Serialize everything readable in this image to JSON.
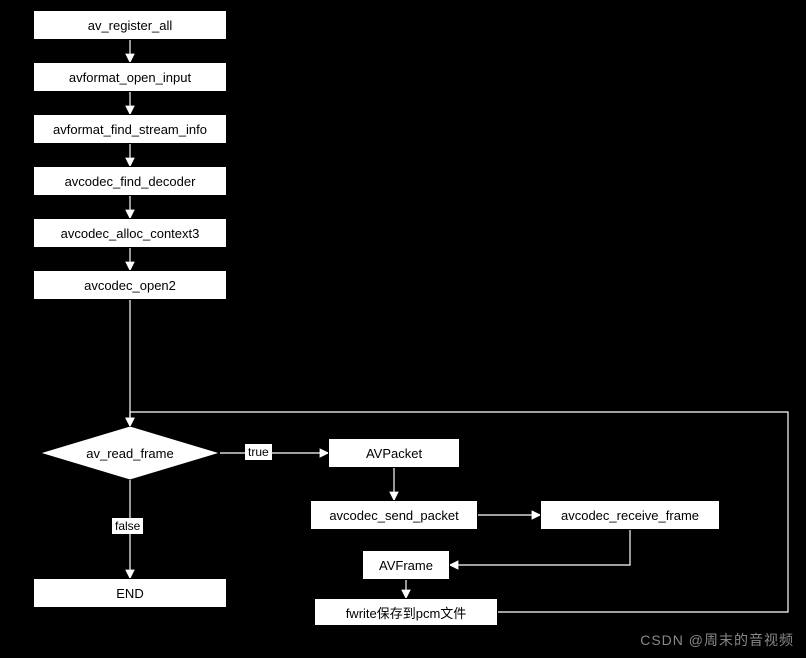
{
  "nodes": {
    "register": "av_register_all",
    "open_input": "avformat_open_input",
    "find_stream": "avformat_find_stream_info",
    "find_decoder": "avcodec_find_decoder",
    "alloc_ctx": "avcodec_alloc_context3",
    "open2": "avcodec_open2",
    "read_frame": "av_read_frame",
    "avpacket": "AVPacket",
    "send_packet": "avcodec_send_packet",
    "receive_frame": "avcodec_receive_frame",
    "avframe": "AVFrame",
    "fwrite": "fwrite保存到pcm文件",
    "end": "END"
  },
  "labels": {
    "true_label": "true",
    "false_label": "false"
  },
  "watermark": "CSDN @周末的音视频",
  "chart_data": {
    "type": "flowchart",
    "title": "",
    "nodes": [
      {
        "id": "register",
        "label": "av_register_all",
        "shape": "rect"
      },
      {
        "id": "open_input",
        "label": "avformat_open_input",
        "shape": "rect"
      },
      {
        "id": "find_stream",
        "label": "avformat_find_stream_info",
        "shape": "rect"
      },
      {
        "id": "find_decoder",
        "label": "avcodec_find_decoder",
        "shape": "rect"
      },
      {
        "id": "alloc_ctx",
        "label": "avcodec_alloc_context3",
        "shape": "rect"
      },
      {
        "id": "open2",
        "label": "avcodec_open2",
        "shape": "rect"
      },
      {
        "id": "read_frame",
        "label": "av_read_frame",
        "shape": "diamond"
      },
      {
        "id": "avpacket",
        "label": "AVPacket",
        "shape": "rect"
      },
      {
        "id": "send_packet",
        "label": "avcodec_send_packet",
        "shape": "rect"
      },
      {
        "id": "receive_frame",
        "label": "avcodec_receive_frame",
        "shape": "rect"
      },
      {
        "id": "avframe",
        "label": "AVFrame",
        "shape": "rect"
      },
      {
        "id": "fwrite",
        "label": "fwrite保存到pcm文件",
        "shape": "rect"
      },
      {
        "id": "end",
        "label": "END",
        "shape": "rect"
      }
    ],
    "edges": [
      {
        "from": "register",
        "to": "open_input"
      },
      {
        "from": "open_input",
        "to": "find_stream"
      },
      {
        "from": "find_stream",
        "to": "find_decoder"
      },
      {
        "from": "find_decoder",
        "to": "alloc_ctx"
      },
      {
        "from": "alloc_ctx",
        "to": "open2"
      },
      {
        "from": "open2",
        "to": "read_frame"
      },
      {
        "from": "read_frame",
        "to": "avpacket",
        "label": "true"
      },
      {
        "from": "read_frame",
        "to": "end",
        "label": "false"
      },
      {
        "from": "avpacket",
        "to": "send_packet"
      },
      {
        "from": "send_packet",
        "to": "receive_frame"
      },
      {
        "from": "receive_frame",
        "to": "avframe"
      },
      {
        "from": "avframe",
        "to": "fwrite"
      },
      {
        "from": "fwrite",
        "to": "read_frame"
      }
    ]
  }
}
